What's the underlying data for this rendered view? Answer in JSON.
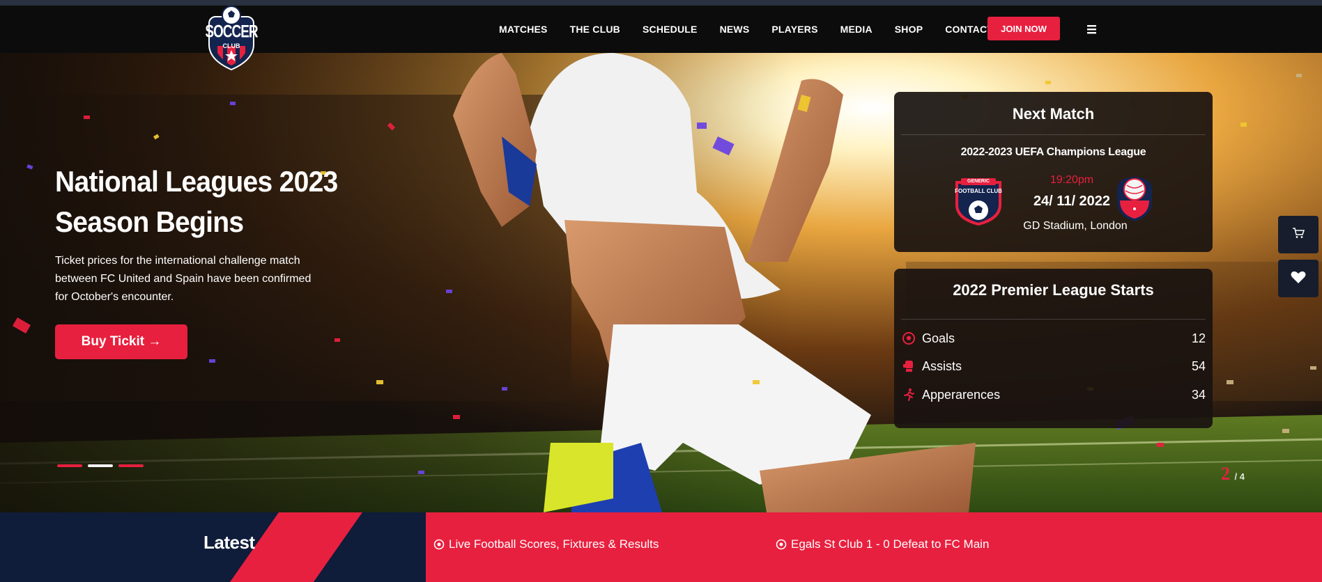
{
  "header": {
    "logo_text_top": "SOCCER",
    "logo_text_bottom": "CLUB",
    "nav": [
      "MATCHES",
      "THE CLUB",
      "SCHEDULE",
      "NEWS",
      "PLAYERS",
      "MEDIA",
      "SHOP",
      "CONTACT"
    ],
    "join_label": "JOIN NOW",
    "menu_icon": "hamburger-icon"
  },
  "hero": {
    "title": "National Leagues 2023 Season Begins",
    "description": "Ticket prices for the international challenge match between FC United and Spain have been confirmed for October's encounter.",
    "button_label": "Buy Tickit →",
    "slide_current": "2",
    "slide_total": "/ 4"
  },
  "next_match": {
    "title": "Next Match",
    "league": "2022-2023 UEFA Champions League",
    "time": "19:20pm",
    "date": "24/ 11/ 2022",
    "venue": "GD Stadium, London",
    "home_badge_top": "GENERIC",
    "home_badge_name": "FOOTBALL CLUB"
  },
  "stats": {
    "title": "2022 Premier League Starts",
    "rows": [
      {
        "label": "Goals",
        "value": "12",
        "icon": "soccer-ball-icon"
      },
      {
        "label": "Assists",
        "value": "54",
        "icon": "boxing-glove-icon"
      },
      {
        "label": "Apperarences",
        "value": "34",
        "icon": "running-person-icon"
      }
    ]
  },
  "side_buttons": {
    "cart_icon": "cart-icon",
    "heart_icon": "heart-icon"
  },
  "ticker": {
    "label": "Latest N",
    "items": [
      "Live Football Scores, Fixtures & Results",
      "Egals St Club 1 - 0 Defeat to FC Main"
    ]
  },
  "colors": {
    "accent": "#e8203f",
    "navy": "#0f1c3a",
    "header_bg": "#0c0c0c"
  }
}
